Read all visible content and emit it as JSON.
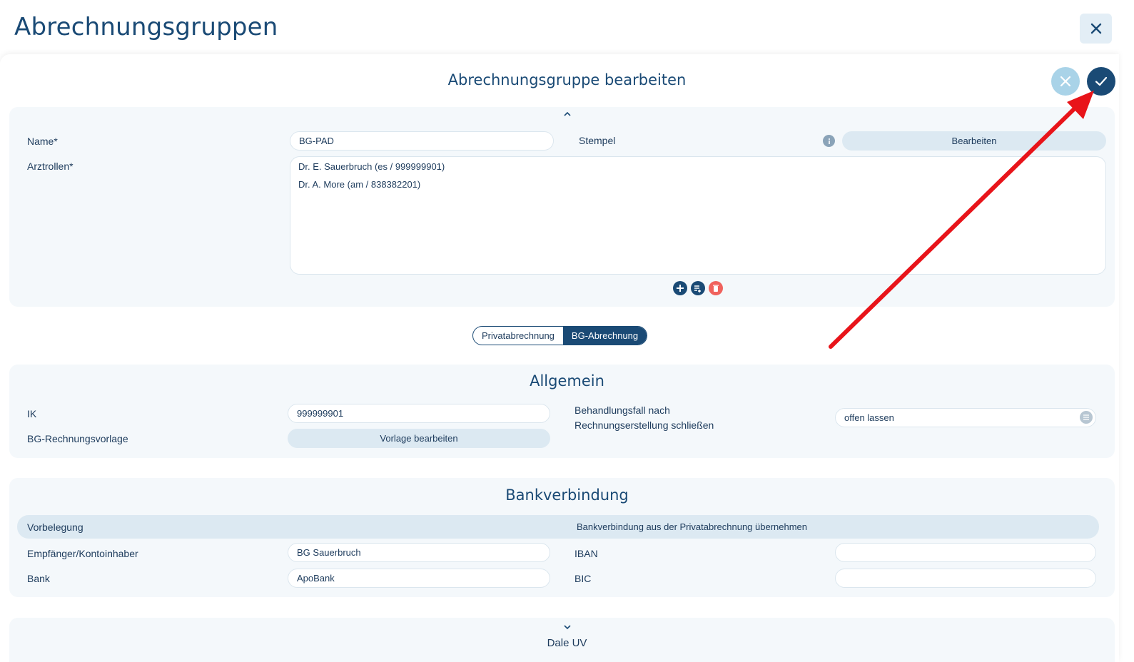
{
  "header": {
    "title": "Abrechnungsgruppen"
  },
  "dialog": {
    "title": "Abrechnungsgruppe bearbeiten"
  },
  "general": {
    "name_label": "Name*",
    "name_value": "BG-PAD",
    "stamp_label": "Stempel",
    "stamp_button": "Bearbeiten",
    "doctor_roles_label": "Arztrollen*",
    "doctor_roles": [
      "Dr. E. Sauerbruch (es / 999999901)",
      "Dr. A. More (am / 838382201)"
    ]
  },
  "billing_toggle": {
    "options": [
      "Privatabrechnung",
      "BG-Abrechnung"
    ],
    "selected": "BG-Abrechnung"
  },
  "allgemein": {
    "heading": "Allgemein",
    "ik_label": "IK",
    "ik_value": "999999901",
    "template_label": "BG-Rechnungsvorlage",
    "template_button": "Vorlage bearbeiten",
    "close_case_label_line1": "Behandlungsfall nach",
    "close_case_label_line2": "Rechnungserstellung schließen",
    "close_case_value": "offen lassen"
  },
  "bank": {
    "heading": "Bankverbindung",
    "preset_label": "Vorbelegung",
    "preset_button": "Bankverbindung aus der Privatabrechnung übernehmen",
    "recipient_label": "Empfänger/Kontoinhaber",
    "recipient_value": "BG Sauerbruch",
    "bank_label": "Bank",
    "bank_value": "ApoBank",
    "iban_label": "IBAN",
    "iban_value": "",
    "bic_label": "BIC",
    "bic_value": ""
  },
  "dale": {
    "heading": "Dale UV"
  },
  "colors": {
    "primary": "#1a4a75",
    "cancel": "#a9d3e8",
    "delete": "#f0625d",
    "annotation_arrow": "#e8141a"
  }
}
